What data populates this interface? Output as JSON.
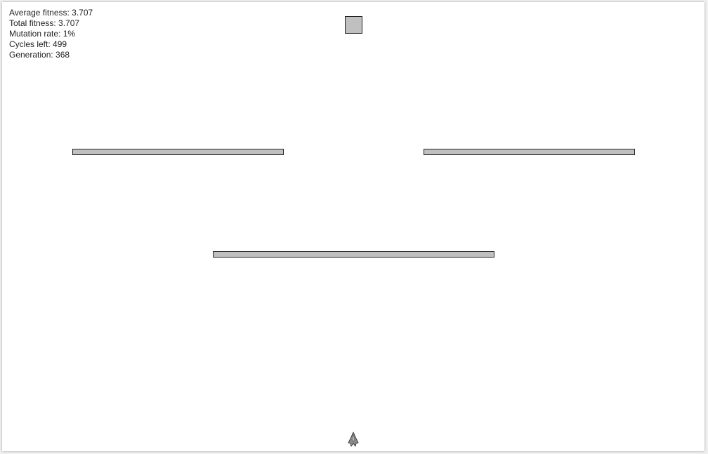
{
  "stats": {
    "average_fitness": "Average fitness: 3.707",
    "total_fitness": "Total fitness: 3.707",
    "mutation_rate": "Mutation rate: 1%",
    "cycles_left": "Cycles left: 499",
    "generation": "Generation: 368"
  },
  "colors": {
    "obstacle_fill": "#c0c0c0",
    "target_fill": "#c0c0c0",
    "rocket_fill": "#8a8a8a",
    "background": "#ffffff"
  },
  "icons": {
    "rocket": "rocket-icon",
    "target": "target-square"
  }
}
